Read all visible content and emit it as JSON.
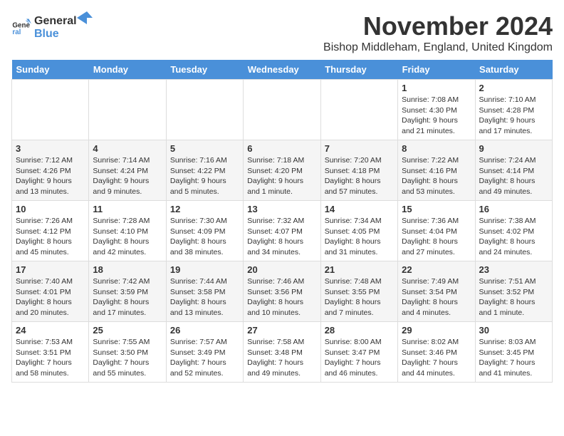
{
  "logo": {
    "text_general": "General",
    "text_blue": "Blue"
  },
  "title": "November 2024",
  "subtitle": "Bishop Middleham, England, United Kingdom",
  "days_of_week": [
    "Sunday",
    "Monday",
    "Tuesday",
    "Wednesday",
    "Thursday",
    "Friday",
    "Saturday"
  ],
  "weeks": [
    [
      {
        "day": "",
        "info": ""
      },
      {
        "day": "",
        "info": ""
      },
      {
        "day": "",
        "info": ""
      },
      {
        "day": "",
        "info": ""
      },
      {
        "day": "",
        "info": ""
      },
      {
        "day": "1",
        "info": "Sunrise: 7:08 AM\nSunset: 4:30 PM\nDaylight: 9 hours and 21 minutes."
      },
      {
        "day": "2",
        "info": "Sunrise: 7:10 AM\nSunset: 4:28 PM\nDaylight: 9 hours and 17 minutes."
      }
    ],
    [
      {
        "day": "3",
        "info": "Sunrise: 7:12 AM\nSunset: 4:26 PM\nDaylight: 9 hours and 13 minutes."
      },
      {
        "day": "4",
        "info": "Sunrise: 7:14 AM\nSunset: 4:24 PM\nDaylight: 9 hours and 9 minutes."
      },
      {
        "day": "5",
        "info": "Sunrise: 7:16 AM\nSunset: 4:22 PM\nDaylight: 9 hours and 5 minutes."
      },
      {
        "day": "6",
        "info": "Sunrise: 7:18 AM\nSunset: 4:20 PM\nDaylight: 9 hours and 1 minute."
      },
      {
        "day": "7",
        "info": "Sunrise: 7:20 AM\nSunset: 4:18 PM\nDaylight: 8 hours and 57 minutes."
      },
      {
        "day": "8",
        "info": "Sunrise: 7:22 AM\nSunset: 4:16 PM\nDaylight: 8 hours and 53 minutes."
      },
      {
        "day": "9",
        "info": "Sunrise: 7:24 AM\nSunset: 4:14 PM\nDaylight: 8 hours and 49 minutes."
      }
    ],
    [
      {
        "day": "10",
        "info": "Sunrise: 7:26 AM\nSunset: 4:12 PM\nDaylight: 8 hours and 45 minutes."
      },
      {
        "day": "11",
        "info": "Sunrise: 7:28 AM\nSunset: 4:10 PM\nDaylight: 8 hours and 42 minutes."
      },
      {
        "day": "12",
        "info": "Sunrise: 7:30 AM\nSunset: 4:09 PM\nDaylight: 8 hours and 38 minutes."
      },
      {
        "day": "13",
        "info": "Sunrise: 7:32 AM\nSunset: 4:07 PM\nDaylight: 8 hours and 34 minutes."
      },
      {
        "day": "14",
        "info": "Sunrise: 7:34 AM\nSunset: 4:05 PM\nDaylight: 8 hours and 31 minutes."
      },
      {
        "day": "15",
        "info": "Sunrise: 7:36 AM\nSunset: 4:04 PM\nDaylight: 8 hours and 27 minutes."
      },
      {
        "day": "16",
        "info": "Sunrise: 7:38 AM\nSunset: 4:02 PM\nDaylight: 8 hours and 24 minutes."
      }
    ],
    [
      {
        "day": "17",
        "info": "Sunrise: 7:40 AM\nSunset: 4:01 PM\nDaylight: 8 hours and 20 minutes."
      },
      {
        "day": "18",
        "info": "Sunrise: 7:42 AM\nSunset: 3:59 PM\nDaylight: 8 hours and 17 minutes."
      },
      {
        "day": "19",
        "info": "Sunrise: 7:44 AM\nSunset: 3:58 PM\nDaylight: 8 hours and 13 minutes."
      },
      {
        "day": "20",
        "info": "Sunrise: 7:46 AM\nSunset: 3:56 PM\nDaylight: 8 hours and 10 minutes."
      },
      {
        "day": "21",
        "info": "Sunrise: 7:48 AM\nSunset: 3:55 PM\nDaylight: 8 hours and 7 minutes."
      },
      {
        "day": "22",
        "info": "Sunrise: 7:49 AM\nSunset: 3:54 PM\nDaylight: 8 hours and 4 minutes."
      },
      {
        "day": "23",
        "info": "Sunrise: 7:51 AM\nSunset: 3:52 PM\nDaylight: 8 hours and 1 minute."
      }
    ],
    [
      {
        "day": "24",
        "info": "Sunrise: 7:53 AM\nSunset: 3:51 PM\nDaylight: 7 hours and 58 minutes."
      },
      {
        "day": "25",
        "info": "Sunrise: 7:55 AM\nSunset: 3:50 PM\nDaylight: 7 hours and 55 minutes."
      },
      {
        "day": "26",
        "info": "Sunrise: 7:57 AM\nSunset: 3:49 PM\nDaylight: 7 hours and 52 minutes."
      },
      {
        "day": "27",
        "info": "Sunrise: 7:58 AM\nSunset: 3:48 PM\nDaylight: 7 hours and 49 minutes."
      },
      {
        "day": "28",
        "info": "Sunrise: 8:00 AM\nSunset: 3:47 PM\nDaylight: 7 hours and 46 minutes."
      },
      {
        "day": "29",
        "info": "Sunrise: 8:02 AM\nSunset: 3:46 PM\nDaylight: 7 hours and 44 minutes."
      },
      {
        "day": "30",
        "info": "Sunrise: 8:03 AM\nSunset: 3:45 PM\nDaylight: 7 hours and 41 minutes."
      }
    ]
  ]
}
